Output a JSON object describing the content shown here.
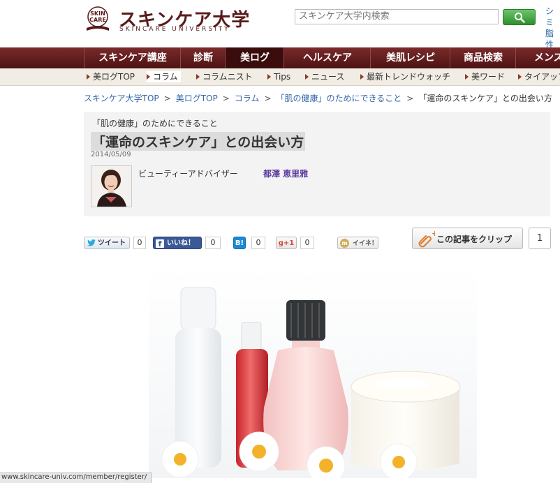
{
  "logo": {
    "badge_text": "SKIN CARE",
    "title": "スキンケア大学",
    "subtitle": "SKINCARE UNIVERSITY"
  },
  "search": {
    "placeholder": "スキンケア大学内検索"
  },
  "header_side": {
    "line1": "シミ",
    "line2": "脂性"
  },
  "nav": {
    "items": [
      {
        "label": "スキンケア講座"
      },
      {
        "label": "診断"
      },
      {
        "label": "美ログ",
        "active": true
      },
      {
        "label": "ヘルスケア"
      },
      {
        "label": "美肌レシピ"
      },
      {
        "label": "商品検索"
      },
      {
        "label": "メンズ"
      }
    ]
  },
  "subnav": {
    "items": [
      {
        "label": "美ログTOP"
      },
      {
        "label": "コラム",
        "active": true
      },
      {
        "label": "コラムニスト"
      },
      {
        "label": "Tips"
      },
      {
        "label": "ニュース"
      },
      {
        "label": "最新トレンドウォッチ"
      },
      {
        "label": "美ワード"
      },
      {
        "label": "タイアップ"
      }
    ]
  },
  "breadcrumb": {
    "items": [
      {
        "label": "スキンケア大学TOP"
      },
      {
        "label": "美ログTOP"
      },
      {
        "label": "コラム"
      },
      {
        "label": "「肌の健康」のためにできること"
      },
      {
        "label": "「運命のスキンケア」との出会い方"
      }
    ],
    "separator": ">"
  },
  "article": {
    "category": "「肌の健康」のためにできること",
    "title": "「運命のスキンケア」との出会い方",
    "date": "2014/05/09",
    "author_role": "ビューティーアドバイザー",
    "author_name": "都澤 恵里雅"
  },
  "social": {
    "tweet_label": "ツイート",
    "tweet_count": "0",
    "like_label": "いいね！",
    "like_count": "0",
    "hatena_label": "B!",
    "hatena_count": "0",
    "gplus_label": "g+1",
    "gplus_count": "0",
    "mixi_label": "イイネ！",
    "clip_label": "この記事をクリップ",
    "clip_count": "1"
  },
  "status_bar": {
    "url": "www.skincare-univ.com/member/register/"
  },
  "colors": {
    "brand": "#5a1a1a",
    "nav_bg": "#6a2222",
    "link": "#3366aa",
    "author": "#5a3aa0",
    "search_button": "#3aa03a"
  }
}
